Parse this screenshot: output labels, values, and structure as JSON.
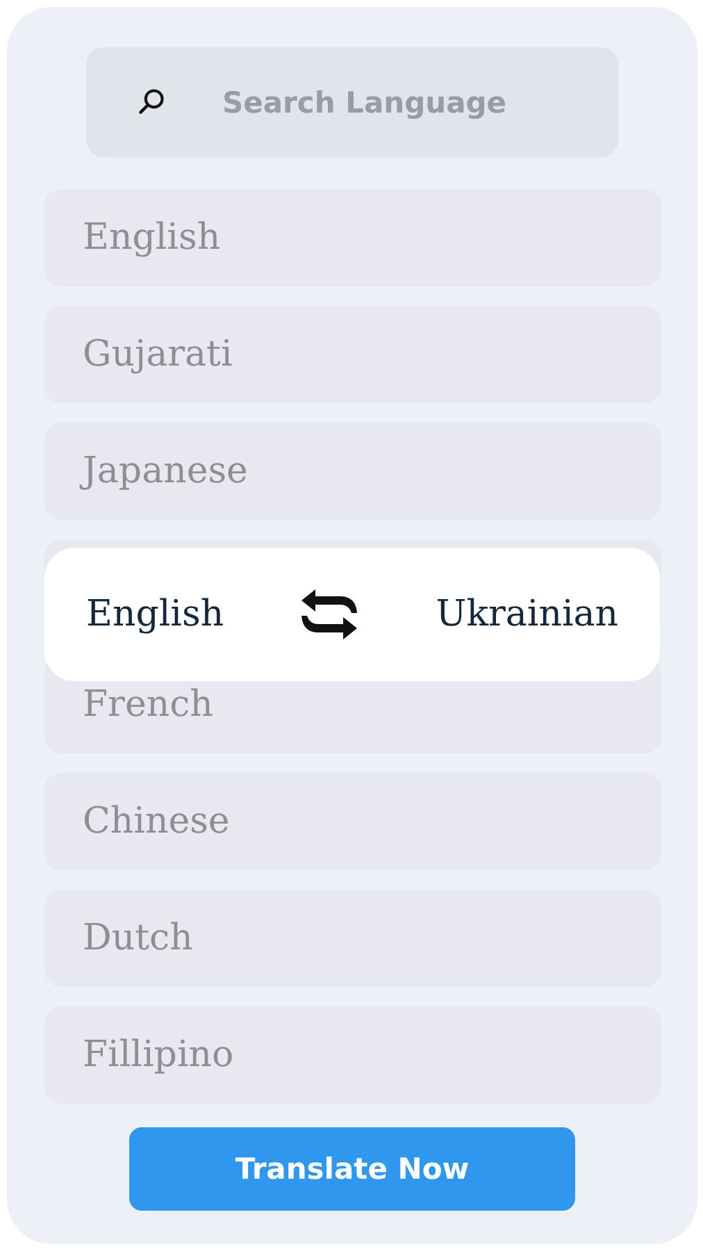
{
  "search": {
    "placeholder": "Search Language"
  },
  "languages": [
    "English",
    "Gujarati",
    "Japanese",
    "French",
    "Chinese",
    "Dutch",
    "Fillipino"
  ],
  "pair": {
    "source": "English",
    "target": "Ukrainian"
  },
  "button": "Translate Now"
}
